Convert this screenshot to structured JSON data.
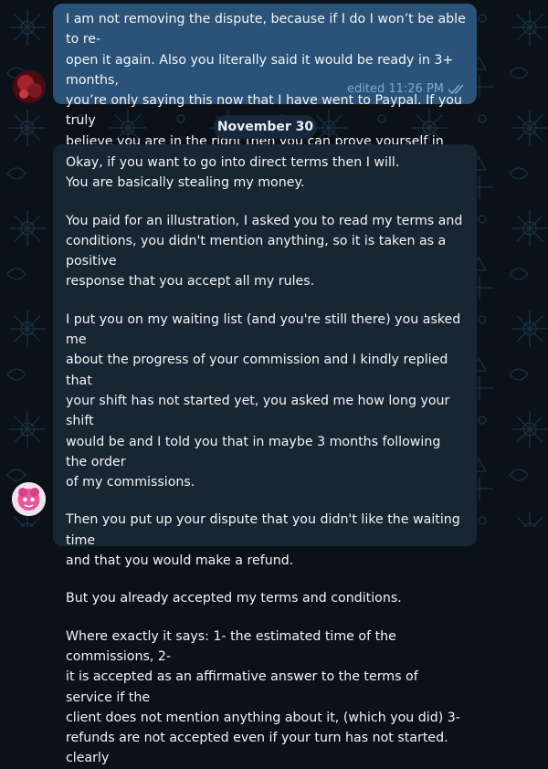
{
  "outgoing_message": {
    "text": "I am not removing the dispute, because if I do I won’t be able to re-\nopen it again. Also you literally said it would be ready in 3+ months,\nyou’re only saying this now that I have went to Paypal. If you truly\nbelieve you are in the right then you can prove yourself in the\ndispute. I am not changing my mind on this.",
    "status": "edited 11:26 PM",
    "read_icon": "double-check-icon"
  },
  "date_separator": "November 30",
  "incoming_message": {
    "paragraphs": [
      "Okay, if you want to go into direct terms then I will.\nYou are basically stealing my money.",
      "You paid for an illustration, I asked you to read my terms and\nconditions, you didn't mention anything, so it is taken as a positive\nresponse that you accept all my rules.",
      "I put you on my waiting list (and you're still there) you asked me\nabout the progress of your commission and I kindly replied that\nyour shift has not started yet, you asked me how long your shift\nwould be and I told you that in maybe 3 months following the order\nof my commissions.",
      "Then you put up your dispute that you didn't like the waiting time\nand that you would make a refund.",
      "But you already accepted my terms and conditions.",
      "Where exactly it says: 1- the estimated time of the commissions, 2-\nit is accepted as an affirmative answer to the terms of service if the\nclient does not mention anything about it, (which you did) 3-\nrefunds are not accepted even if your turn has not started. clearly"
    ]
  },
  "colors": {
    "outgoing_bubble": "#2b5278",
    "incoming_bubble": "#182533",
    "background": "#0b1118",
    "meta_text": "#7eaad2"
  }
}
